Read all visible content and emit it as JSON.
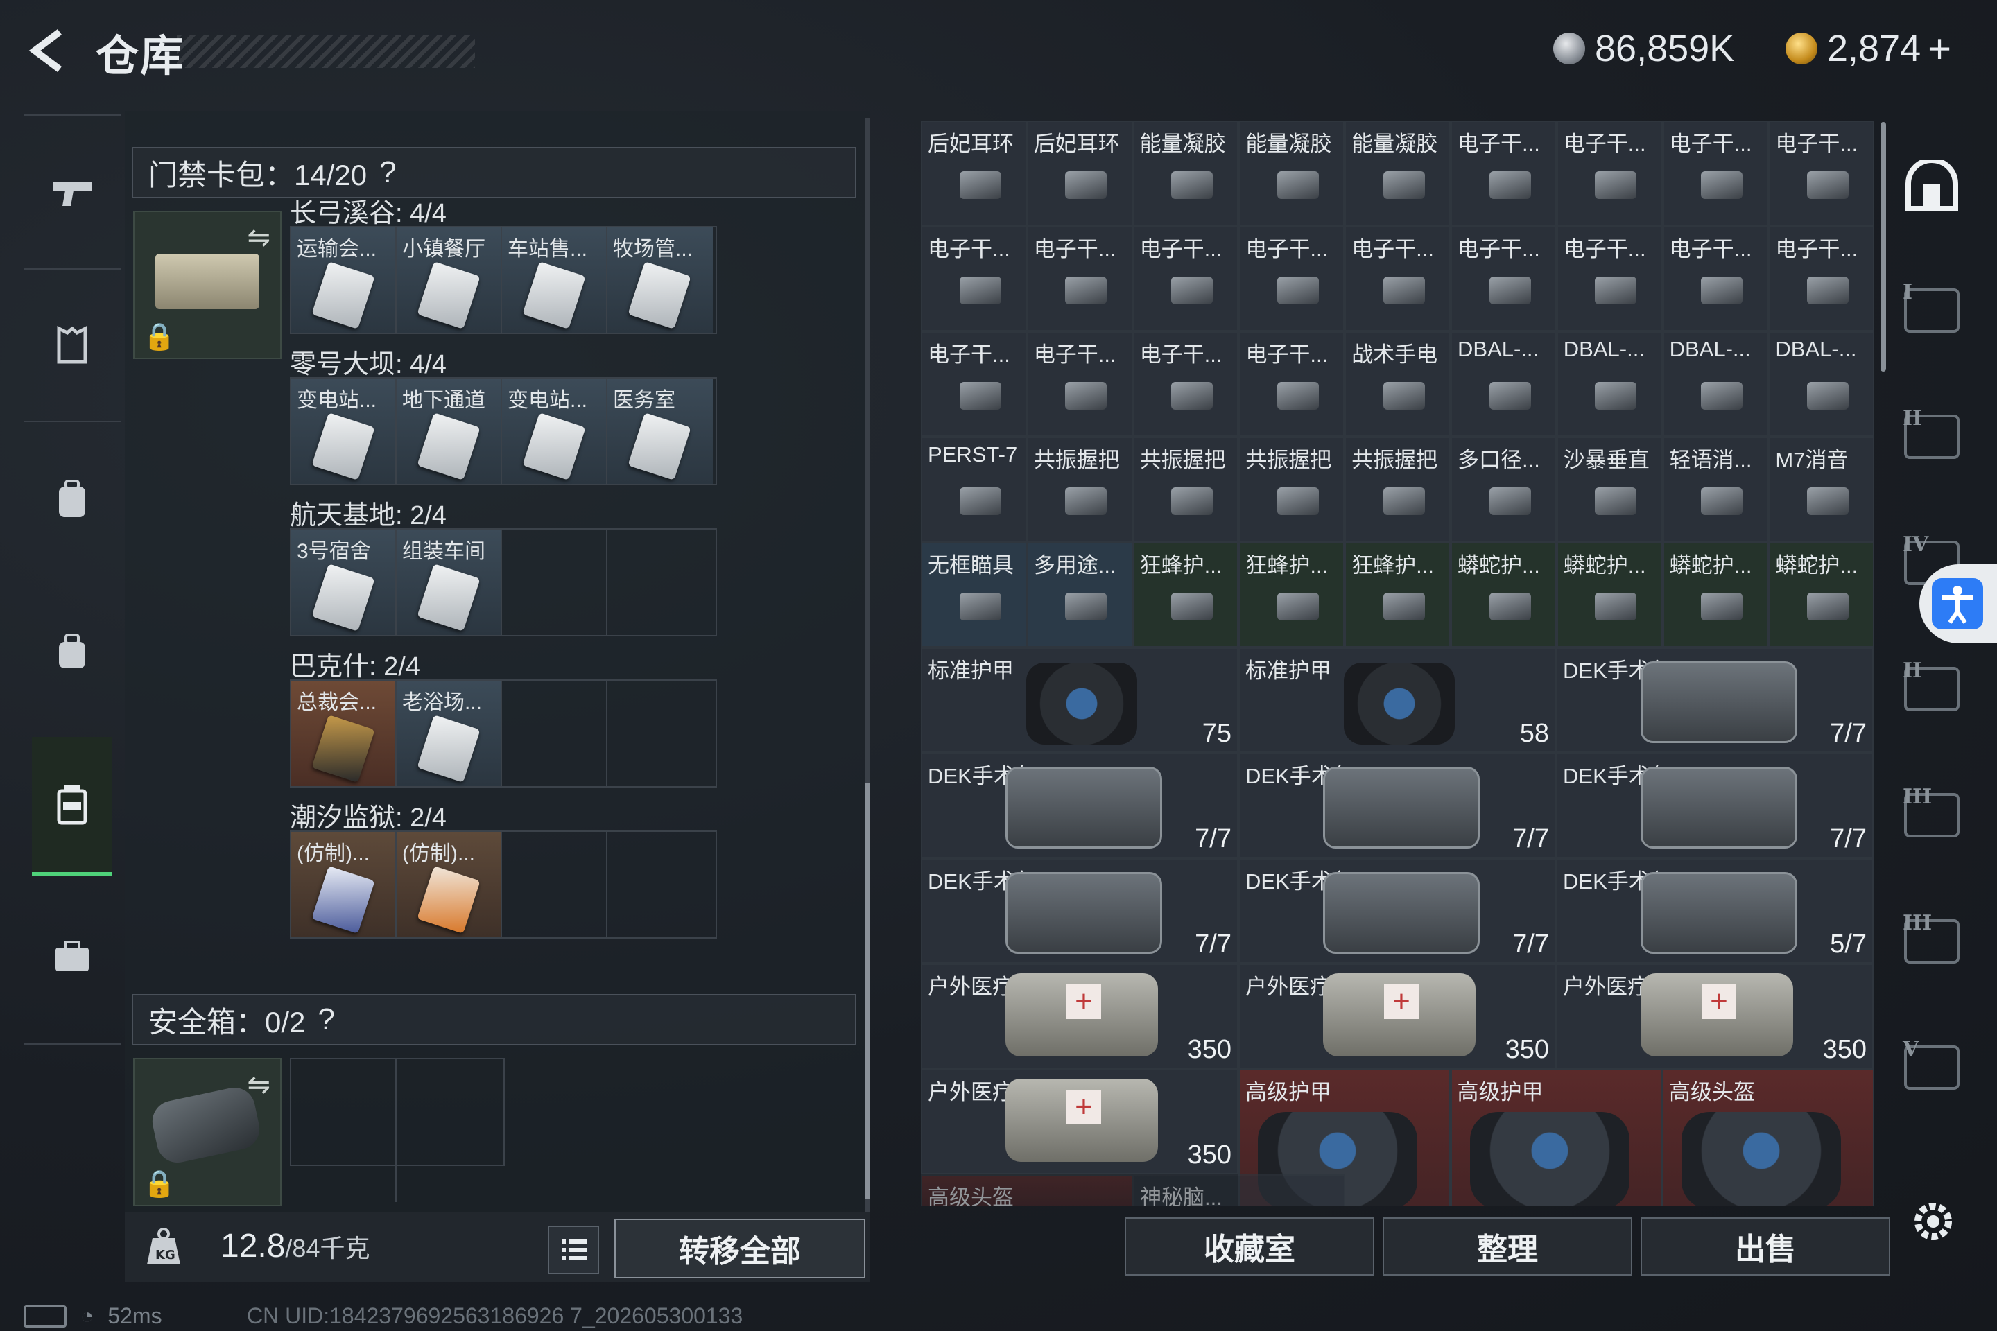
{
  "header": {
    "title": "仓库",
    "currency_1": "86,859K",
    "currency_2": "2,874",
    "currency_2_plus": "+"
  },
  "left_nav": {
    "icons": [
      "gun-icon",
      "armor-icon",
      "backpack-icon",
      "bag-icon",
      "keycard-case-icon",
      "briefcase-icon"
    ],
    "active": 4
  },
  "keycard_pack": {
    "header": "门禁卡包：14/20",
    "help": "?",
    "groups": [
      {
        "name": "长弓溪谷: 4/4",
        "slots": [
          {
            "label": "运输会...",
            "style": "filled"
          },
          {
            "label": "小镇餐厅",
            "style": "filled"
          },
          {
            "label": "车站售...",
            "style": "filled"
          },
          {
            "label": "牧场管...",
            "style": "filled"
          }
        ]
      },
      {
        "name": "零号大坝: 4/4",
        "slots": [
          {
            "label": "变电站...",
            "style": "filled"
          },
          {
            "label": "地下通道",
            "style": "filled"
          },
          {
            "label": "变电站...",
            "style": "filled"
          },
          {
            "label": "医务室",
            "style": "filled"
          }
        ]
      },
      {
        "name": "航天基地: 2/4",
        "slots": [
          {
            "label": "3号宿舍",
            "style": "filled"
          },
          {
            "label": "组装车间",
            "style": "filled"
          },
          {
            "label": "",
            "style": "empty"
          },
          {
            "label": "",
            "style": "empty"
          }
        ]
      },
      {
        "name": "巴克什: 2/4",
        "slots": [
          {
            "label": "总裁会...",
            "style": "gold"
          },
          {
            "label": "老浴场...",
            "style": "filled"
          },
          {
            "label": "",
            "style": "empty"
          },
          {
            "label": "",
            "style": "empty"
          }
        ]
      },
      {
        "name": "潮汐监狱: 2/4",
        "slots": [
          {
            "label": "(仿制)...",
            "style": "orange"
          },
          {
            "label": "(仿制)...",
            "style": "orange"
          },
          {
            "label": "",
            "style": "empty"
          },
          {
            "label": "",
            "style": "empty"
          }
        ]
      }
    ]
  },
  "safe_box": {
    "header": "安全箱：0/2",
    "help": "?"
  },
  "weight": {
    "value": "12.8",
    "unit": "/84千克"
  },
  "transfer_all": "转移全部",
  "grid": {
    "small_rows": [
      [
        {
          "l": "后妃耳环",
          "c": ""
        },
        {
          "l": "后妃耳环",
          "c": ""
        },
        {
          "l": "能量凝胶",
          "c": ""
        },
        {
          "l": "能量凝胶",
          "c": ""
        },
        {
          "l": "能量凝胶",
          "c": ""
        },
        {
          "l": "电子干...",
          "c": ""
        },
        {
          "l": "电子干...",
          "c": ""
        },
        {
          "l": "电子干...",
          "c": ""
        },
        {
          "l": "电子干...",
          "c": ""
        }
      ],
      [
        {
          "l": "电子干...",
          "c": ""
        },
        {
          "l": "电子干...",
          "c": ""
        },
        {
          "l": "电子干...",
          "c": ""
        },
        {
          "l": "电子干...",
          "c": ""
        },
        {
          "l": "电子干...",
          "c": ""
        },
        {
          "l": "电子干...",
          "c": ""
        },
        {
          "l": "电子干...",
          "c": ""
        },
        {
          "l": "电子干...",
          "c": ""
        },
        {
          "l": "电子干...",
          "c": ""
        }
      ],
      [
        {
          "l": "电子干...",
          "c": ""
        },
        {
          "l": "电子干...",
          "c": ""
        },
        {
          "l": "电子干...",
          "c": ""
        },
        {
          "l": "电子干...",
          "c": ""
        },
        {
          "l": "战术手电",
          "c": ""
        },
        {
          "l": "DBAL-...",
          "c": ""
        },
        {
          "l": "DBAL-...",
          "c": ""
        },
        {
          "l": "DBAL-...",
          "c": ""
        },
        {
          "l": "DBAL-...",
          "c": ""
        }
      ],
      [
        {
          "l": "PERST-7",
          "c": ""
        },
        {
          "l": "共振握把",
          "c": ""
        },
        {
          "l": "共振握把",
          "c": ""
        },
        {
          "l": "共振握把",
          "c": ""
        },
        {
          "l": "共振握把",
          "c": ""
        },
        {
          "l": "多口径...",
          "c": ""
        },
        {
          "l": "沙暴垂直",
          "c": ""
        },
        {
          "l": "轻语消...",
          "c": ""
        },
        {
          "l": "M7消音",
          "c": ""
        }
      ],
      [
        {
          "l": "无框瞄具",
          "c": "blue"
        },
        {
          "l": "多用途...",
          "c": "blue"
        },
        {
          "l": "狂蜂护...",
          "c": "green"
        },
        {
          "l": "狂蜂护...",
          "c": "green"
        },
        {
          "l": "狂蜂护...",
          "c": "green"
        },
        {
          "l": "蟒蛇护...",
          "c": "green"
        },
        {
          "l": "蟒蛇护...",
          "c": "green"
        },
        {
          "l": "蟒蛇护...",
          "c": "green"
        },
        {
          "l": "蟒蛇护...",
          "c": "green"
        }
      ]
    ],
    "big_rows": [
      [
        {
          "l": "标准护甲",
          "b": "75",
          "k": "armor",
          "c": ""
        },
        {
          "l": "标准护甲",
          "b": "58",
          "k": "armor",
          "c": ""
        },
        {
          "l": "DEK手术包",
          "b": "7/7",
          "k": "medkit",
          "c": ""
        }
      ],
      [
        {
          "l": "DEK手术包",
          "b": "7/7",
          "k": "medkit",
          "c": ""
        },
        {
          "l": "DEK手术包",
          "b": "7/7",
          "k": "medkit",
          "c": ""
        },
        {
          "l": "DEK手术包",
          "b": "7/7",
          "k": "medkit",
          "c": ""
        }
      ],
      [
        {
          "l": "DEK手术包",
          "b": "7/7",
          "k": "medkit",
          "c": ""
        },
        {
          "l": "DEK手术包",
          "b": "7/7",
          "k": "medkit",
          "c": ""
        },
        {
          "l": "DEK手术包",
          "b": "5/7",
          "k": "medkit",
          "c": ""
        }
      ],
      [
        {
          "l": "户外医疗箱",
          "b": "350",
          "k": "firstaid",
          "c": ""
        },
        {
          "l": "户外医疗箱",
          "b": "350",
          "k": "firstaid",
          "c": ""
        },
        {
          "l": "户外医疗箱",
          "b": "350",
          "k": "firstaid",
          "c": ""
        }
      ]
    ],
    "last_row": [
      {
        "l": "户外医疗箱",
        "b": "350",
        "k": "firstaid",
        "c": ""
      },
      {
        "l": "高级护甲",
        "b": "",
        "k": "redarmor",
        "c": "red"
      },
      {
        "l": "高级护甲",
        "b": "",
        "k": "redarmor",
        "c": "red"
      },
      {
        "l": "高级头盔",
        "b": "",
        "k": "redarmor",
        "c": "red"
      }
    ],
    "partial_labels": [
      "高级头盔",
      "神秘脑..."
    ]
  },
  "bottom_buttons": {
    "collection": "收藏室",
    "sort": "整理",
    "sell": "出售"
  },
  "right_sidebar": [
    "I",
    "II",
    "IV",
    "II",
    "III",
    "III",
    "V",
    "IV"
  ],
  "status": {
    "ping": "52ms",
    "uid": "CN UID:1842379692563186926 7_202605300133"
  },
  "colors": {
    "accent_green": "#4fd27a",
    "rare_red": "#5a2a2a",
    "access_blue": "#2d7cf6"
  }
}
